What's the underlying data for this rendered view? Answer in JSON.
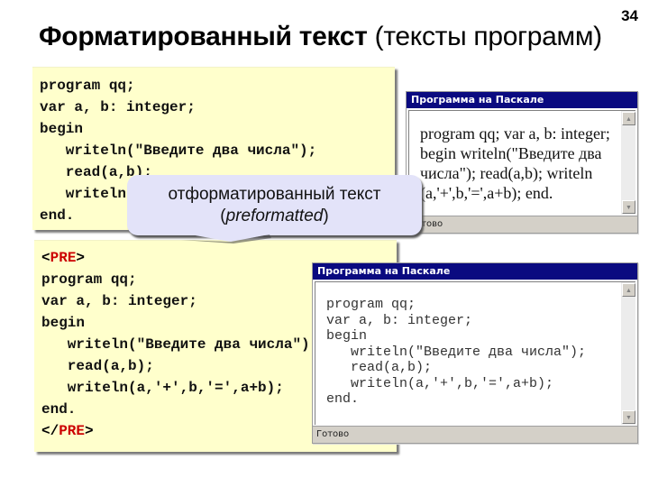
{
  "slide": {
    "number": "34",
    "title_bold": "Форматированный текст",
    "title_normal": "(тексты программ)"
  },
  "code_plain": {
    "lines": [
      "program qq;",
      "var a, b: integer;",
      "begin",
      "   writeln(\"Введите два числа\");",
      "   read(a,b);",
      "   writeln(a,'+',b,'=',a+b);",
      "end."
    ]
  },
  "code_pre": {
    "open_tag_prefix": "<",
    "tag_name": "PRE",
    "open_tag_suffix": ">",
    "close_tag_prefix": "</",
    "close_tag_suffix": ">",
    "lines": [
      "program qq;",
      "var a, b: integer;",
      "begin",
      "   writeln(\"Введите два числа\");",
      "   read(a,b);",
      "   writeln(a,'+',b,'=',a+b);",
      "end."
    ],
    "tag_color": "#cc0000"
  },
  "window_plain": {
    "title": "Программа на Паскале",
    "text": "program qq; var a, b: integer; begin writeln(\"Введите два числа\"); read(a,b); writeln (a,'+',b,'=',a+b); end.",
    "status": "Готово"
  },
  "window_pre": {
    "title": "Программа на Паскале",
    "text": "program qq;\nvar a, b: integer;\nbegin\n   writeln(\"Введите два числа\");\n   read(a,b);\n   writeln(a,'+',b,'=',a+b);\nend.",
    "status": "Готово"
  },
  "callout": {
    "line1": "отформатированный текст",
    "paren_open": "(",
    "italic": "preformatted",
    "paren_close": ")"
  },
  "colors": {
    "code_bg": "#ffffcc",
    "titlebar_bg": "#0a0a80",
    "callout_bg": "#e3e3f9"
  }
}
